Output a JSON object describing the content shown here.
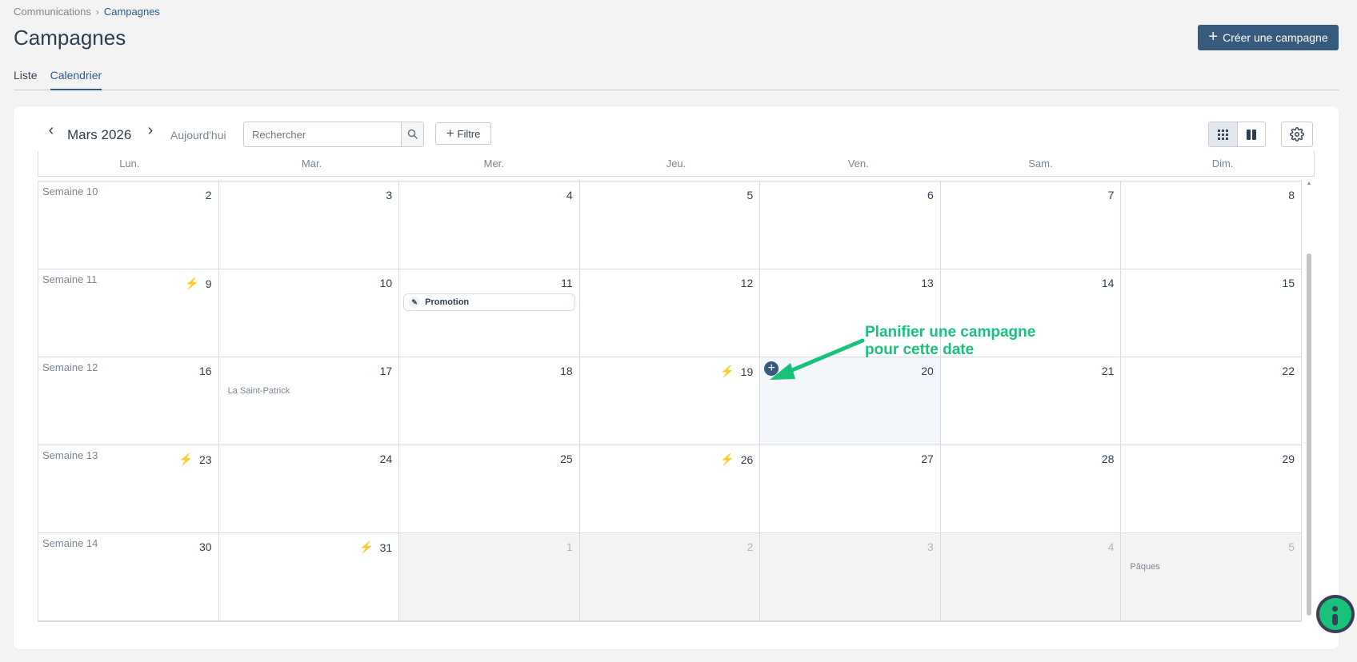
{
  "breadcrumb": {
    "parent": "Communications",
    "current": "Campagnes"
  },
  "page_title": "Campagnes",
  "create_button": "Créer une campagne",
  "tabs": [
    {
      "label": "Liste"
    },
    {
      "label": "Calendrier"
    }
  ],
  "toolbar": {
    "month": "Mars 2026",
    "today": "Aujourd'hui",
    "search_placeholder": "Rechercher",
    "filter": "Filtre"
  },
  "weekdays": [
    "Lun.",
    "Mar.",
    "Mer.",
    "Jeu.",
    "Ven.",
    "Sam.",
    "Dim."
  ],
  "weeks": [
    {
      "label": "Semaine 10",
      "days": [
        "2",
        "3",
        "4",
        "5",
        "6",
        "7",
        "8"
      ]
    },
    {
      "label": "Semaine 11",
      "days": [
        "9",
        "10",
        "11",
        "12",
        "13",
        "14",
        "15"
      ]
    },
    {
      "label": "Semaine 12",
      "days": [
        "16",
        "17",
        "18",
        "19",
        "20",
        "21",
        "22"
      ]
    },
    {
      "label": "Semaine 13",
      "days": [
        "23",
        "24",
        "25",
        "26",
        "27",
        "28",
        "29"
      ]
    },
    {
      "label": "Semaine 14",
      "days": [
        "30",
        "31",
        "1",
        "2",
        "3",
        "4",
        "5"
      ]
    }
  ],
  "event": {
    "label": "Promotion"
  },
  "holidays": {
    "saint_patrick": "La Saint-Patrick",
    "paques": "Pâques"
  },
  "annotation": {
    "line1": "Planifier une campagne",
    "line2": "pour cette date"
  },
  "colors": {
    "primary": "#365b7e",
    "bolt": "#8a3ff0",
    "annotation": "#19c27a"
  }
}
